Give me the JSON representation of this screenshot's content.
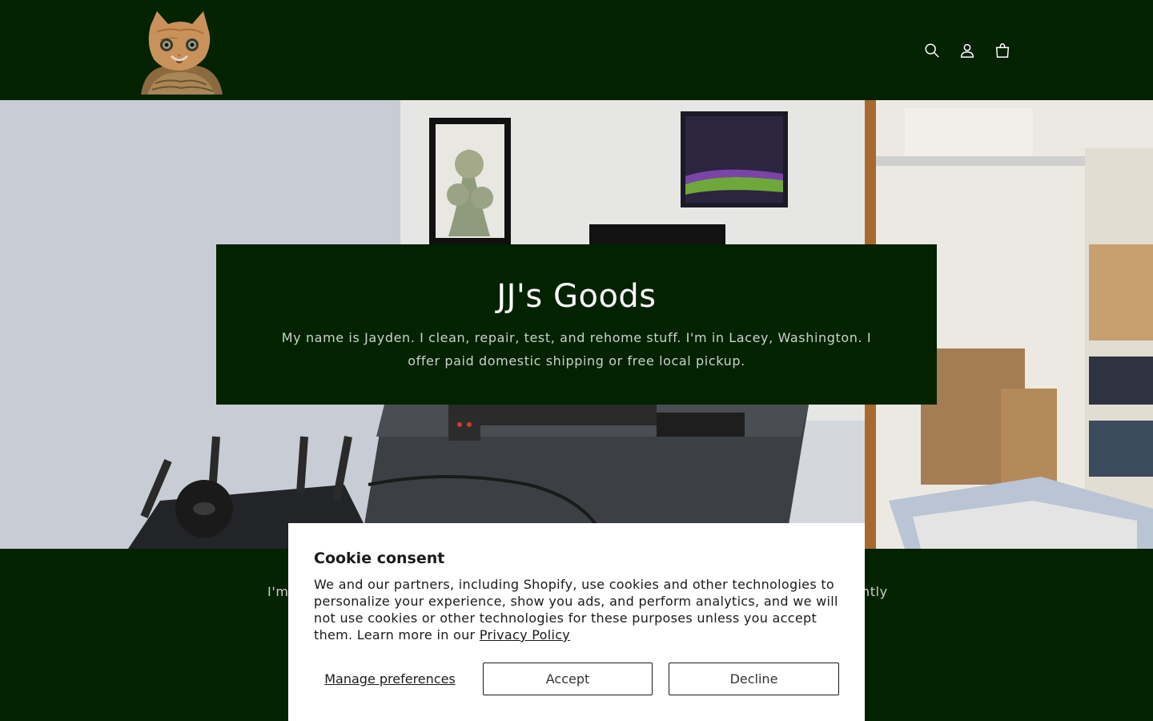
{
  "header": {
    "logo_alt": "cat logo",
    "icons": [
      "search-icon",
      "account-icon",
      "cart-icon"
    ]
  },
  "hero": {
    "title": "JJ's Goods",
    "text": "My name is Jayden. I clean, repair, test, and rehome stuff. I'm in Lacey, Washington. I offer paid domestic shipping or free local pickup."
  },
  "below": {
    "left_fragment": "I'm",
    "right_fragment": "ntly"
  },
  "cookie": {
    "title": "Cookie consent",
    "body": "We and our partners, including Shopify, use cookies and other technologies to personalize your experience, show you ads, and perform analytics, and we will not use cookies or other technologies for these purposes unless you accept them. Learn more in our",
    "privacy_link": "Privacy Policy",
    "manage_label": "Manage preferences",
    "accept_label": "Accept",
    "decline_label": "Decline"
  },
  "colors": {
    "brand_green": "#022200",
    "banner_bg": "#ffffff"
  }
}
